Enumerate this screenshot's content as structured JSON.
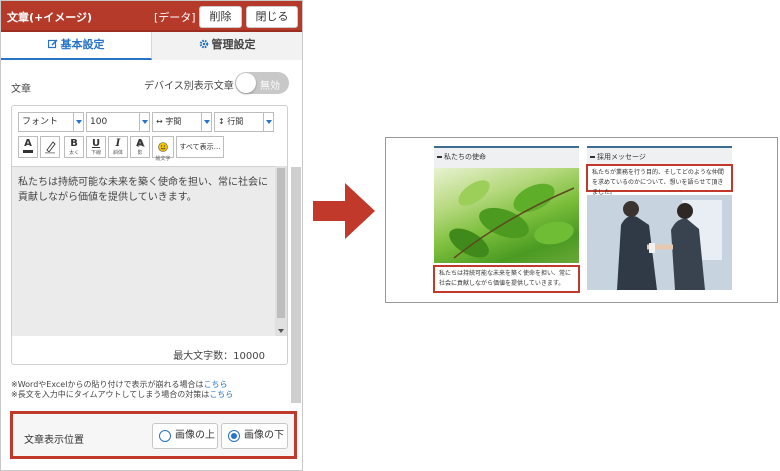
{
  "editor": {
    "title": "文章(+イメージ)",
    "data_tag": "[データ]",
    "delete_label": "削除",
    "close_label": "閉じる",
    "tabs": [
      {
        "label": "基本設定",
        "icon": "edit-icon",
        "active": true
      },
      {
        "label": "管理設定",
        "icon": "gear-icon",
        "active": false
      }
    ],
    "field_label": "文章",
    "device_label": "デバイス別表示文章",
    "toggle_label": "無効",
    "toolbar": {
      "font_select": "フォント",
      "size_select": "100",
      "spacing_select": "字間",
      "line_select": "行間",
      "buttons": [
        {
          "glyph": "A",
          "sub": "",
          "icon": "text-color-icon"
        },
        {
          "glyph": "",
          "sub": "",
          "icon": "highlighter-icon"
        },
        {
          "glyph": "B",
          "sub": "太く",
          "icon": "bold-icon"
        },
        {
          "glyph": "U",
          "sub": "下線",
          "icon": "underline-icon"
        },
        {
          "glyph": "I",
          "sub": "斜体",
          "icon": "italic-icon"
        },
        {
          "glyph": "A",
          "sub": "影",
          "icon": "shadow-icon"
        },
        {
          "glyph": "",
          "sub": "絵文字",
          "icon": "emoji-icon"
        }
      ],
      "show_all": "すべて表示…"
    },
    "body_text": "私たちは持続可能な未来を築く使命を担い、常に社会に貢献しながら価値を提供していきます。",
    "max_chars": "最大文字数：10000",
    "note1_prefix": "※WordやExcelからの貼り付けで表示が崩れる場合は",
    "note1_link": "こちら",
    "note2_prefix": "※長文を入力中にタイムアウトしてしまう場合の対策は",
    "note2_link": "こちら",
    "position_label": "文章表示位置",
    "position_options": [
      {
        "label": "画像の上",
        "selected": false
      },
      {
        "label": "画像の下",
        "selected": true
      }
    ]
  },
  "preview": {
    "col1_heading": "私たちの使命",
    "col1_caption": "私たちは持続可能な未来を築く使命を担い、常に社会に貢献しながら価値を提供していきます。",
    "col2_heading": "採用メッセージ",
    "col2_caption": "私たちが業務を行う目的、そしてどのような仲間を求めているのかについて、想いを語らせて頂きました。"
  },
  "colors": {
    "header": "#b63a2a",
    "accent": "#2673c8",
    "highlight_border": "#c0392b"
  }
}
